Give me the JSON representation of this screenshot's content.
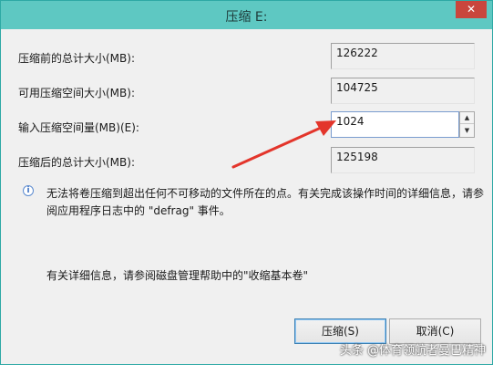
{
  "window": {
    "title": "压缩 E:",
    "close_label": "✕"
  },
  "fields": [
    {
      "label": "压缩前的总计大小(MB):",
      "value": "126222"
    },
    {
      "label": "可用压缩空间大小(MB):",
      "value": "104725"
    },
    {
      "label": "输入压缩空间量(MB)(E):",
      "value": "1024"
    },
    {
      "label": "压缩后的总计大小(MB):",
      "value": "125198"
    }
  ],
  "spinner": {
    "up_glyph": "▲",
    "down_glyph": "▼"
  },
  "info": {
    "icon": "info-icon",
    "text": "无法将卷压缩到超出任何不可移动的文件所在的点。有关完成该操作时间的详细信息，请参阅应用程序日志中的 \"defrag\" 事件。"
  },
  "help": {
    "text": "有关详细信息，请参阅磁盘管理帮助中的\"收缩基本卷\""
  },
  "buttons": {
    "shrink": "压缩(S)",
    "cancel": "取消(C)"
  },
  "watermark": {
    "text": "头条 @体育领航者曼巴精神"
  },
  "colors": {
    "titlebar": "#5ec8c2",
    "close": "#c9463d",
    "arrow": "#e3352b"
  }
}
